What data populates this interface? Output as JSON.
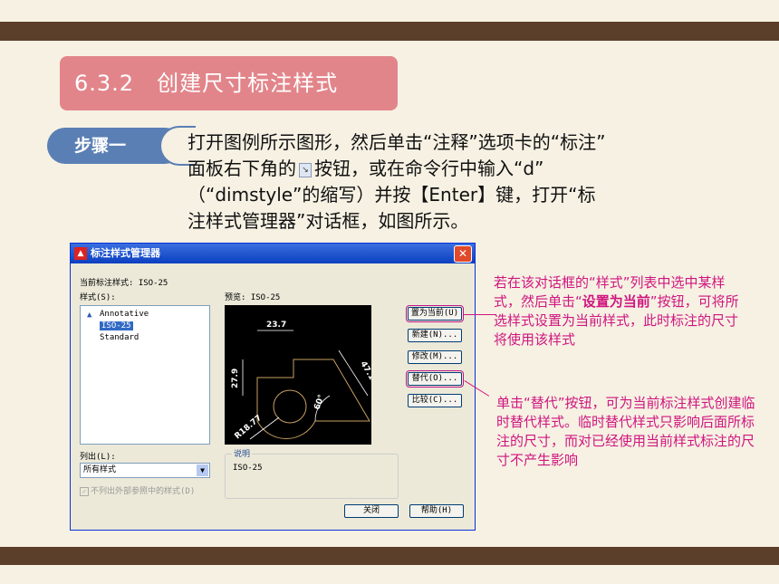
{
  "section_title": "6.3.2　创建尺寸标注样式",
  "step_label": "步骤一",
  "instruction": {
    "line1": "打开图例所示图形，然后单击“注释”选项卡的“标注”",
    "line2_a": "面板右下角的",
    "line2_b": "按钮，或在命令行中输入“d”",
    "line3": "（“dimstyle”的缩写）并按【Enter】键，打开“标",
    "line4": "注样式管理器”对话框，如图所示。"
  },
  "dialog": {
    "title": "标注样式管理器",
    "current_style_label": "当前标注样式: ISO-25",
    "styles_label": "样式(S):",
    "styles": [
      "Annotative",
      "ISO-25",
      "Standard"
    ],
    "selected_style": "ISO-25",
    "preview_label": "预览: ISO-25",
    "list_label": "列出(L):",
    "list_value": "所有样式",
    "checkbox_label": "不列出外部参照中的样式(D)",
    "description_label": "说明",
    "description_value": "ISO-25",
    "buttons": {
      "set_current": "置为当前(U)",
      "new": "新建(N)...",
      "modify": "修改(M)...",
      "override": "替代(O)...",
      "compare": "比较(C)...",
      "close": "关闭",
      "help": "帮助(H)"
    },
    "preview_dims": {
      "top": "23.7",
      "left": "27.9",
      "right": "47.15",
      "angle": "60°",
      "radius": "R18.77"
    }
  },
  "callouts": {
    "first_a": "若在该对话框的“样式”列表中选中某样式，然后单击“",
    "first_bold": "设置为当前",
    "first_b": "”按钮，可将所选样式设置为当前样式，此时标注的尺寸将使用该样式",
    "second": "单击“替代”按钮，可为当前标注样式创建临时替代样式。临时替代样式只影响后面所标注的尺寸，而对已经使用当前样式标注的尺寸不产生影响"
  },
  "colors": {
    "band": "#5b3f2a",
    "title_bg": "#e2858a",
    "badge": "#5a7fb4",
    "callout": "#d0157f"
  }
}
